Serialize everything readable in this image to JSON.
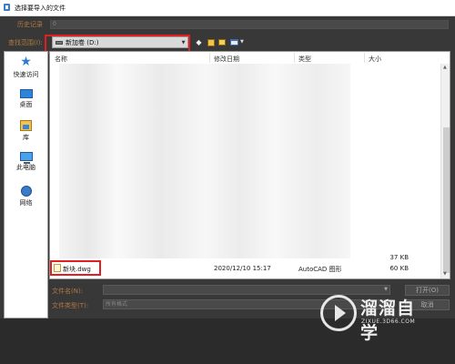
{
  "window": {
    "title": "选择要导入的文件"
  },
  "history": {
    "label": "历史记录",
    "value": "0"
  },
  "lookin": {
    "label": "查找范围(I):",
    "drive": "新加卷 (D:)"
  },
  "places": [
    {
      "label": "快速访问",
      "icon": "star-icon"
    },
    {
      "label": "桌面",
      "icon": "desktop-icon"
    },
    {
      "label": "库",
      "icon": "library-icon"
    },
    {
      "label": "此电脑",
      "icon": "computer-icon"
    },
    {
      "label": "网络",
      "icon": "network-icon"
    }
  ],
  "columns": {
    "name": "名称",
    "date": "修改日期",
    "type": "类型",
    "size": "大小"
  },
  "files": [
    {
      "name": "",
      "date": "",
      "type": "",
      "size": "37 KB"
    },
    {
      "name": "新块.dwg",
      "date": "2020/12/10 15:17",
      "type": "AutoCAD 图形",
      "size": "60 KB"
    }
  ],
  "filename": {
    "label": "文件名(N):",
    "value": ""
  },
  "filetype": {
    "label": "文件类型(T):",
    "value": "所有格式"
  },
  "buttons": {
    "open": "打开(O)",
    "cancel": "取消"
  },
  "watermark": {
    "title": "溜溜自学",
    "url": "ZIXUE.3D66.COM"
  },
  "colors": {
    "highlight": "#e02020",
    "label": "#b07a40",
    "dialog_bg": "#383838"
  }
}
